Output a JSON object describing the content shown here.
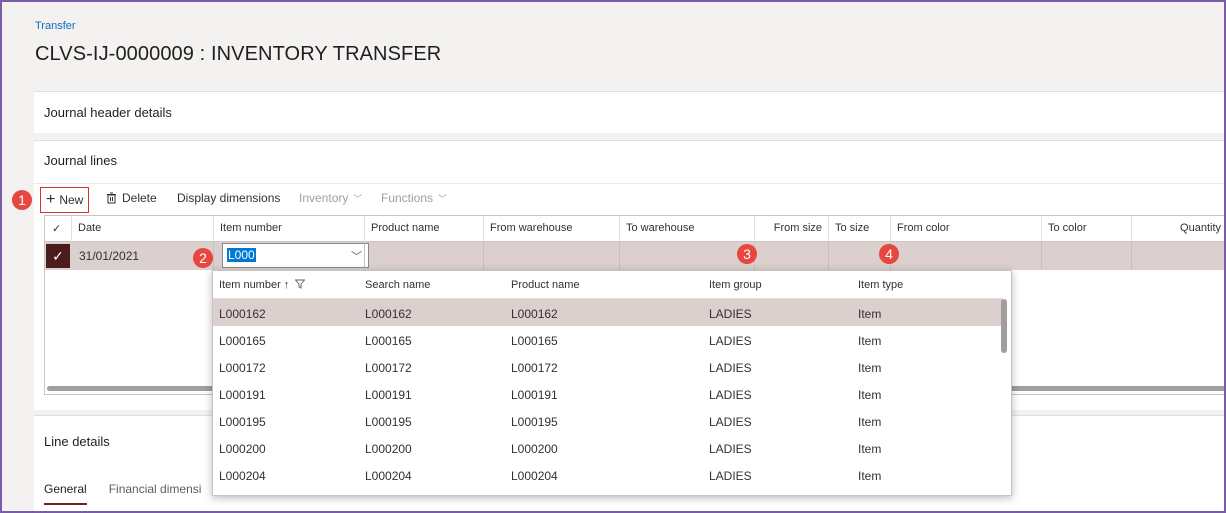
{
  "breadcrumb": "Transfer",
  "page_title": "CLVS-IJ-0000009 : INVENTORY TRANSFER",
  "sections": {
    "header_details": "Journal header details",
    "journal_lines": "Journal lines",
    "line_details": "Line details"
  },
  "toolbar": {
    "new": "New",
    "delete": "Delete",
    "display_dimensions": "Display dimensions",
    "inventory": "Inventory",
    "functions": "Functions"
  },
  "grid": {
    "columns": [
      "Date",
      "Item number",
      "Product name",
      "From warehouse",
      "To warehouse",
      "From size",
      "To size",
      "From color",
      "To color",
      "Quantity"
    ],
    "row": {
      "date": "31/01/2021",
      "item_number": "L000"
    }
  },
  "callouts": [
    "1",
    "2",
    "3",
    "4"
  ],
  "lookup": {
    "columns": [
      "Item number ↑",
      "Search name",
      "Product name",
      "Item group",
      "Item type"
    ],
    "rows": [
      [
        "L000162",
        "L000162",
        "L000162",
        "LADIES",
        "Item"
      ],
      [
        "L000165",
        "L000165",
        "L000165",
        "LADIES",
        "Item"
      ],
      [
        "L000172",
        "L000172",
        "L000172",
        "LADIES",
        "Item"
      ],
      [
        "L000191",
        "L000191",
        "L000191",
        "LADIES",
        "Item"
      ],
      [
        "L000195",
        "L000195",
        "L000195",
        "LADIES",
        "Item"
      ],
      [
        "L000200",
        "L000200",
        "L000200",
        "LADIES",
        "Item"
      ],
      [
        "L000204",
        "L000204",
        "L000204",
        "LADIES",
        "Item"
      ]
    ]
  },
  "tabs": [
    "General",
    "Financial dimensi"
  ],
  "colors": {
    "accent": "#6b2323",
    "callout": "#e8473f",
    "selected_row": "#dbd0cd",
    "link": "#0f6cbd"
  }
}
